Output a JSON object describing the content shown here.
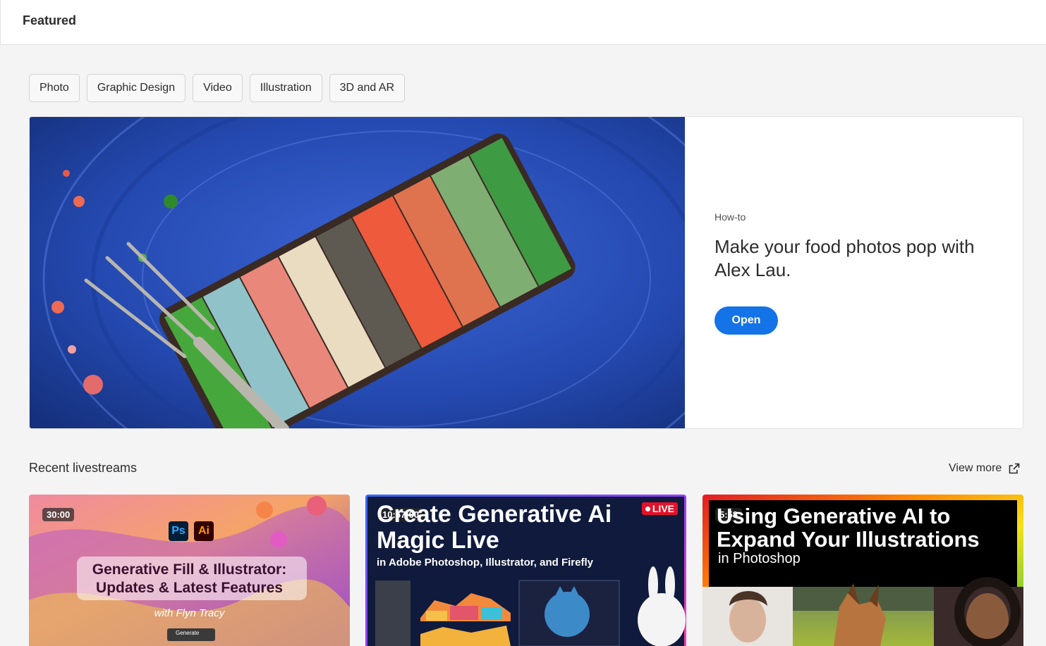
{
  "header": {
    "title": "Featured"
  },
  "filters": [
    {
      "label": "Photo"
    },
    {
      "label": "Graphic Design"
    },
    {
      "label": "Video"
    },
    {
      "label": "Illustration"
    },
    {
      "label": "3D and AR"
    }
  ],
  "featured": {
    "eyebrow": "How-to",
    "title": "Make your food photos pop with Alex Lau.",
    "button": "Open",
    "image_icon": "rainbow-layer-cake-photo"
  },
  "livestreams": {
    "title": "Recent livestreams",
    "view_more": "View more",
    "view_more_icon": "external-link-icon",
    "cards": [
      {
        "duration": "30:00",
        "app_badges": [
          "Ps",
          "Ai"
        ],
        "headline": [
          "Generative Fill & Illustrator:",
          "Updates & Latest Features"
        ],
        "byline": "with Flyn Tracy",
        "generate_label": "Generate"
      },
      {
        "duration": "10:57:00",
        "live_label": "LIVE",
        "headline": [
          "Create Generative Ai",
          "Magic Live"
        ],
        "subline": "in Adobe Photoshop, Illustrator, and Firefly"
      },
      {
        "duration": "5:58",
        "headline": [
          "Using Generative AI to",
          "Expand Your Illustrations"
        ],
        "subline": "in Photoshop"
      }
    ]
  },
  "colors": {
    "accent": "#1473e6",
    "background": "#f4f4f4",
    "live": "#e3122a"
  }
}
